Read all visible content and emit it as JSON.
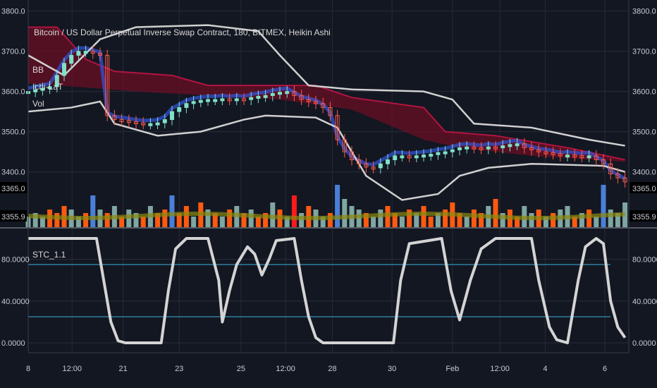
{
  "chart_data": {
    "type": "candlestick",
    "title": "Bitcoin / US Dollar Perpetual Inverse Swap Contract, 180, BITMEX, Heikin Ashi",
    "indicators": [
      "BB",
      "Ichi-LaT",
      "Vol"
    ],
    "price_axis": {
      "ticks": [
        "3800.0",
        "3700.0",
        "3600.0",
        "3500.0",
        "3400.0"
      ],
      "range": [
        3380,
        3810
      ]
    },
    "volume_axis": {
      "labels": [
        "3365.0",
        "3355.9"
      ]
    },
    "x_ticks": [
      {
        "t": 0,
        "label": "8"
      },
      {
        "t": 6.1,
        "label": "12:00"
      },
      {
        "t": 13.2,
        "label": "21"
      },
      {
        "t": 21,
        "label": "23"
      },
      {
        "t": 29.6,
        "label": "25"
      },
      {
        "t": 35.8,
        "label": "12:00"
      },
      {
        "t": 42.3,
        "label": "28"
      },
      {
        "t": 50.6,
        "label": "30"
      },
      {
        "t": 59,
        "label": "Feb"
      },
      {
        "t": 65.6,
        "label": "12:00"
      },
      {
        "t": 71.9,
        "label": "4"
      },
      {
        "t": 80.2,
        "label": "6"
      }
    ],
    "price_close": [
      3600,
      3604,
      3608,
      3612,
      3640,
      3670,
      3690,
      3700,
      3700,
      3695,
      3690,
      3540,
      3530,
      3528,
      3525,
      3522,
      3520,
      3520,
      3522,
      3530,
      3550,
      3560,
      3570,
      3575,
      3578,
      3580,
      3580,
      3582,
      3580,
      3582,
      3580,
      3585,
      3588,
      3590,
      3595,
      3598,
      3600,
      3590,
      3580,
      3575,
      3570,
      3560,
      3540,
      3480,
      3450,
      3430,
      3420,
      3412,
      3410,
      3420,
      3430,
      3440,
      3440,
      3438,
      3440,
      3442,
      3444,
      3448,
      3450,
      3455,
      3460,
      3462,
      3460,
      3458,
      3462,
      3460,
      3465,
      3468,
      3470,
      3460,
      3455,
      3450,
      3448,
      3445,
      3440,
      3442,
      3440,
      3438,
      3440,
      3430,
      3420,
      3395,
      3385,
      3375
    ],
    "bb_upper": [
      [
        0,
        3690
      ],
      [
        5,
        3640
      ],
      [
        10,
        3730
      ],
      [
        15,
        3760
      ],
      [
        25,
        3765
      ],
      [
        32,
        3750
      ],
      [
        35,
        3690
      ],
      [
        39,
        3615
      ],
      [
        45,
        3605
      ],
      [
        55,
        3600
      ],
      [
        59,
        3580
      ],
      [
        62,
        3520
      ],
      [
        70,
        3510
      ],
      [
        78,
        3480
      ],
      [
        83,
        3465
      ]
    ],
    "bb_lower": [
      [
        0,
        3550
      ],
      [
        6,
        3560
      ],
      [
        10,
        3575
      ],
      [
        12,
        3520
      ],
      [
        18,
        3490
      ],
      [
        24,
        3500
      ],
      [
        30,
        3530
      ],
      [
        33,
        3540
      ],
      [
        40,
        3535
      ],
      [
        43,
        3510
      ],
      [
        47,
        3390
      ],
      [
        52,
        3330
      ],
      [
        57,
        3345
      ],
      [
        60,
        3390
      ],
      [
        64,
        3410
      ],
      [
        70,
        3420
      ],
      [
        80,
        3415
      ],
      [
        83,
        3400
      ]
    ],
    "cloud_top": [
      [
        0,
        3760
      ],
      [
        4,
        3760
      ],
      [
        8,
        3680
      ],
      [
        12,
        3650
      ],
      [
        20,
        3640
      ],
      [
        25,
        3615
      ],
      [
        40,
        3615
      ],
      [
        45,
        3585
      ],
      [
        55,
        3560
      ],
      [
        58,
        3500
      ],
      [
        65,
        3490
      ],
      [
        75,
        3460
      ],
      [
        83,
        3430
      ]
    ],
    "cloud_bottom": [
      [
        0,
        3620
      ],
      [
        8,
        3610
      ],
      [
        15,
        3600
      ],
      [
        25,
        3590
      ],
      [
        35,
        3580
      ],
      [
        45,
        3555
      ],
      [
        55,
        3480
      ],
      [
        60,
        3460
      ],
      [
        70,
        3440
      ],
      [
        83,
        3425
      ]
    ],
    "volume": [
      3,
      4,
      3,
      5,
      4,
      6,
      5,
      3,
      4,
      9,
      5,
      4,
      6,
      3,
      5,
      4,
      3,
      6,
      4,
      5,
      9,
      4,
      6,
      3,
      7,
      5,
      4,
      3,
      5,
      6,
      4,
      5,
      3,
      4,
      7,
      5,
      3,
      9,
      4,
      6,
      5,
      3,
      4,
      12,
      8,
      6,
      5,
      4,
      3,
      5,
      6,
      4,
      3,
      5,
      4,
      6,
      3,
      4,
      5,
      7,
      4,
      3,
      5,
      4,
      6,
      8,
      4,
      5,
      3,
      6,
      4,
      5,
      3,
      4,
      5,
      6,
      3,
      4,
      5,
      3,
      12,
      5,
      4,
      7
    ],
    "volume_direction": [
      1,
      1,
      1,
      0,
      0,
      0,
      1,
      1,
      0,
      1,
      1,
      0,
      1,
      0,
      1,
      1,
      0,
      1,
      0,
      0,
      1,
      0,
      0,
      1,
      0,
      1,
      0,
      1,
      0,
      1,
      0,
      1,
      0,
      0,
      1,
      0,
      1,
      0,
      1,
      0,
      1,
      1,
      0,
      1,
      1,
      1,
      1,
      0,
      1,
      1,
      0,
      0,
      1,
      0,
      1,
      0,
      0,
      1,
      0,
      0,
      0,
      1,
      0,
      0,
      1,
      0,
      1,
      0,
      0,
      1,
      1,
      0,
      1,
      0,
      1,
      1,
      0,
      1,
      0,
      1,
      1,
      1,
      1,
      1
    ],
    "stc": {
      "label": "STC_1.1",
      "ticks": [
        "80.0000",
        "40.0000",
        "0.0000"
      ],
      "range": [
        0,
        100
      ],
      "levels": [
        75,
        25
      ],
      "points": [
        [
          0,
          100
        ],
        [
          9.5,
          100
        ],
        [
          10.5,
          60
        ],
        [
          11.5,
          20
        ],
        [
          12.5,
          2
        ],
        [
          13.5,
          0
        ],
        [
          18.5,
          0
        ],
        [
          19.5,
          50
        ],
        [
          20.5,
          90
        ],
        [
          22,
          100
        ],
        [
          25,
          100
        ],
        [
          26.5,
          60
        ],
        [
          27,
          20
        ],
        [
          28,
          50
        ],
        [
          29,
          75
        ],
        [
          30.5,
          92
        ],
        [
          31.5,
          85
        ],
        [
          32.5,
          65
        ],
        [
          33.5,
          80
        ],
        [
          34.5,
          98
        ],
        [
          37,
          100
        ],
        [
          38,
          60
        ],
        [
          39,
          25
        ],
        [
          40,
          5
        ],
        [
          41,
          0
        ],
        [
          50.8,
          0
        ],
        [
          51.8,
          60
        ],
        [
          53,
          95
        ],
        [
          57.5,
          100
        ],
        [
          58.8,
          50
        ],
        [
          60,
          22
        ],
        [
          61.5,
          60
        ],
        [
          63,
          90
        ],
        [
          65,
          100
        ],
        [
          70,
          100
        ],
        [
          71,
          60
        ],
        [
          72.5,
          15
        ],
        [
          73.5,
          3
        ],
        [
          75,
          0
        ],
        [
          76.5,
          60
        ],
        [
          77.5,
          92
        ],
        [
          79,
          100
        ],
        [
          80,
          95
        ],
        [
          81,
          40
        ],
        [
          82,
          15
        ],
        [
          83,
          5
        ]
      ]
    }
  }
}
